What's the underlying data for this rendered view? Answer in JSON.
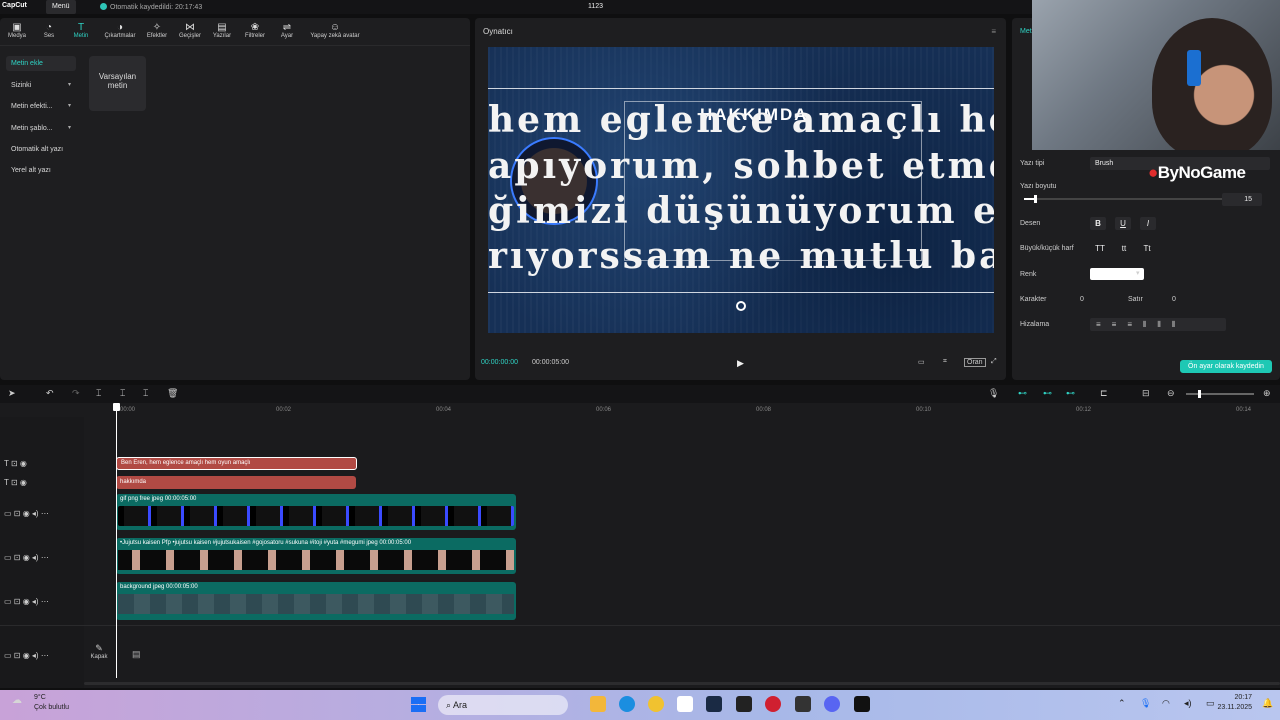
{
  "titlebar": {
    "app": "CapCut",
    "menu": "Menü",
    "autosave": "Otomatik kaydedildi: 20:17:43",
    "project": "1123"
  },
  "toolbar": [
    "Medya",
    "Ses",
    "Metin",
    "Çıkartmalar",
    "Efektler",
    "Geçişler",
    "Yazılar",
    "Filtreler",
    "Ayar",
    "Yapay zekâ avatar"
  ],
  "sidebar": [
    {
      "label": "Metin ekle",
      "active": true
    },
    {
      "label": "Sizinki",
      "chevron": true
    },
    {
      "label": "Metin efekti...",
      "chevron": true
    },
    {
      "label": "Metin şablo...",
      "chevron": true
    },
    {
      "label": "Otomatik alt yazı"
    },
    {
      "label": "Yerel alt yazı"
    }
  ],
  "default_card": "Varsayılan metin",
  "player": {
    "title": "Oynatıcı",
    "time_current": "00:00:00:00",
    "time_total": "00:00:05:00",
    "btn_ratio": "Oran",
    "overlay": "HAKKIMDA",
    "lines": [
      "hem eglence amaçlı hem o",
      "apıyorum, sohbet etmeyi g",
      "ğimizi düşünüyorum eger",
      "rıyorssam ne mutlu bana"
    ]
  },
  "right": {
    "tab": "Metin",
    "font_label": "Yazı tipi",
    "font_value": "Brush",
    "size_label": "Yazı boyutu",
    "size_value": "15",
    "pattern_label": "Desen",
    "case_label": "Büyük/küçük harf",
    "color_label": "Renk",
    "char_label": "Karakter",
    "char_value": "0",
    "line_label": "Satır",
    "line_value": "0",
    "align_label": "Hizalama",
    "save_default": "Ön ayar olarak kaydedin",
    "watermark": "ByNoGame"
  },
  "timeline": {
    "ruler": [
      "00:00",
      "00:02",
      "00:04",
      "00:06",
      "00:08",
      "00:10",
      "00:12",
      "00:14"
    ],
    "clips": {
      "text1": "Ben Eren, hem eglence amaçlı hem oyun amaçlı",
      "text2": "hakkımda",
      "gif": "gif png free jpeg  00:00:05:00",
      "jjk": "•Jujutsu kaisen Pfp •jujutsu kaisen #jujutsukaisen #gojosatoru #sukuna #itoji #yuta #megumi jpeg  00:00:05:00",
      "bg": "background jpeg  00:00:05:00"
    },
    "cover": "Kapak"
  },
  "taskbar": {
    "temp": "9°C",
    "weather": "Çok bulutlu",
    "search": "Ara",
    "time": "20:17",
    "date": "23.11.2025"
  }
}
